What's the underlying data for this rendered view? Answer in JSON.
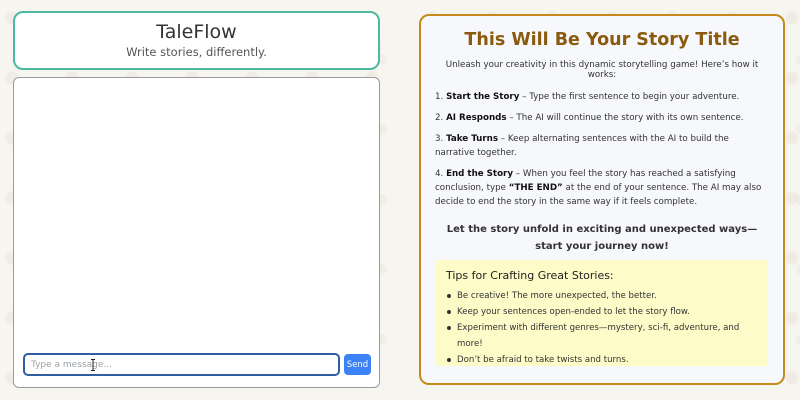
{
  "header": {
    "title": "TaleFlow",
    "tagline": "Write stories, differently."
  },
  "chat": {
    "input_placeholder": "Type a message...",
    "input_value": "",
    "send_label": "Send"
  },
  "instructions": {
    "title": "This Will Be Your Story Title",
    "intro": "Unleash your creativity in this dynamic storytelling game! Here’s how it works:",
    "steps": [
      {
        "number": "1.",
        "label": "Start the Story",
        "text": " – Type the first sentence to begin your adventure."
      },
      {
        "number": "2.",
        "label": "AI Responds",
        "text": " – The AI will continue the story with its own sentence."
      },
      {
        "number": "3.",
        "label": "Take Turns",
        "text": " – Keep alternating sentences with the AI to build the narrative together."
      },
      {
        "number": "4.",
        "label": "End the Story",
        "text_before": " – When you feel the story has reached a satisfying conclusion, type ",
        "emphasis": "“THE END”",
        "text_after": " at the end of your sentence. The AI may also decide to end the story in the same way if it feels complete."
      }
    ],
    "cta": "Let the story unfold in exciting and unexpected ways—start your journey now!"
  },
  "tips": {
    "title": "Tips for Crafting Great Stories:",
    "items": [
      "Be creative! The more unexpected, the better.",
      "Keep your sentences open-ended to let the story flow.",
      "Experiment with different genres—mystery, sci-fi, adventure, and more!",
      "Don’t be afraid to take twists and turns."
    ]
  },
  "colors": {
    "header_border": "#4fb8a0",
    "instructions_border": "#c48a1c",
    "title_color": "#8a5a0e",
    "send_button": "#3b82f6",
    "tips_background": "#fdfbc8"
  },
  "icons": {
    "cursor": "text-cursor-icon"
  }
}
